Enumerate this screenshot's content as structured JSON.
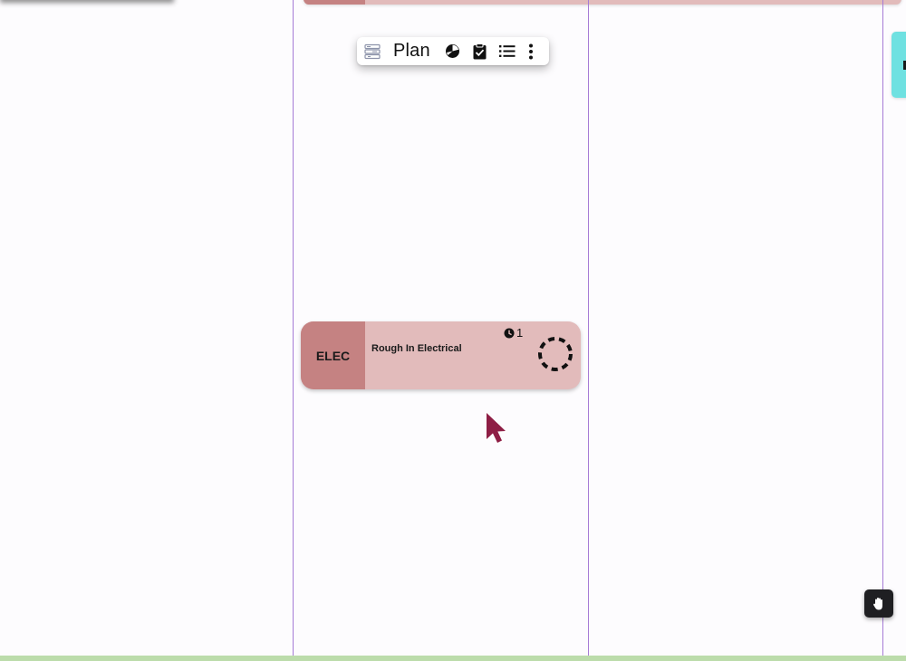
{
  "toolbar": {
    "plan_label": "Plan",
    "icons": [
      "rows-icon",
      "pie-chart-icon",
      "clipboard-check-icon",
      "list-icon",
      "more-vertical-icon"
    ]
  },
  "task": {
    "trade": "ELEC",
    "title": "Rough In Electrical",
    "duration_count": "1",
    "status": "not-started",
    "colors": {
      "tag": "#c58282",
      "body": "#e2bbbb"
    }
  },
  "hand_tool": {
    "icon": "hand-icon"
  },
  "colors": {
    "column_line": "#a67bd6",
    "bottom_bar": "#bcdcab",
    "cyan_card": "#6fe1e1",
    "cursor": "#8e1e45"
  }
}
